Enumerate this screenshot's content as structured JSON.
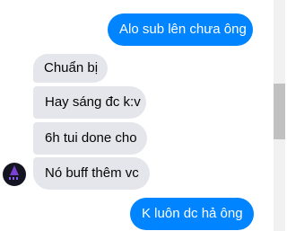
{
  "messages": [
    {
      "direction": "outgoing",
      "text": "Alo sub lên chưa ông"
    },
    {
      "direction": "incoming",
      "text": "Chuẩn bị"
    },
    {
      "direction": "incoming",
      "text": "Hay sáng đc k:v"
    },
    {
      "direction": "incoming",
      "text": "6h tui done cho"
    },
    {
      "direction": "incoming",
      "text": "Nó buff thêm vc"
    },
    {
      "direction": "outgoing",
      "text": "K luôn dc hả ông"
    }
  ],
  "colors": {
    "outgoing_bubble": "#0084ff",
    "incoming_bubble": "#e4e6eb",
    "avatar_background": "#151522",
    "avatar_accent": "#7b3fd1"
  },
  "icons": {
    "avatar": "contact-avatar-icon"
  }
}
